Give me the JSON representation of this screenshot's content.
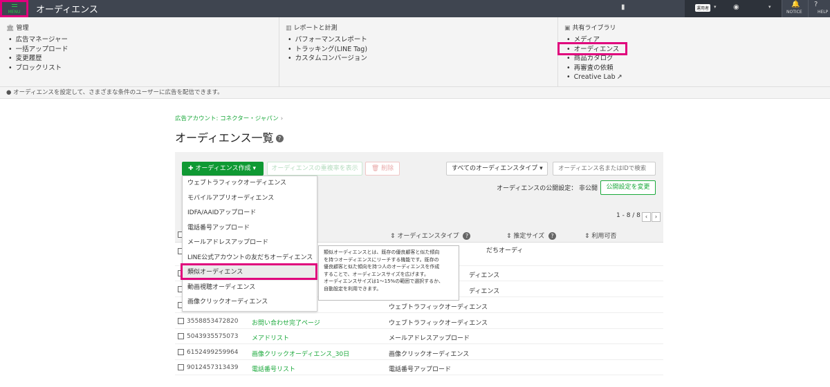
{
  "topbar": {
    "menu_label": "MENU",
    "title": "オーディエンス",
    "account": "運用者",
    "notice": "NOTICE",
    "help": "HELP"
  },
  "mega_menu": {
    "columns": [
      {
        "heading": "管理",
        "icon": "bank-icon",
        "items": [
          "広告マネージャー",
          "一括アップロード",
          "変更履歴",
          "ブロックリスト"
        ]
      },
      {
        "heading": "レポートと計測",
        "icon": "bar-chart-icon",
        "items": [
          "パフォーマンスレポート",
          "トラッキング(LINE Tag)",
          "カスタムコンバージョン"
        ]
      },
      {
        "heading": "共有ライブラリ",
        "icon": "image-icon",
        "items": [
          "メディア",
          "オーディエンス",
          "商品カタログ",
          "再審査の依頼",
          "Creative Lab"
        ]
      }
    ]
  },
  "info": "オーディエンスを設定して、さまざまな条件のユーザーに広告を配信できます。",
  "breadcrumb": {
    "account": "広告アカウント: コネクター・ジャパン",
    "sep": "›"
  },
  "page_title": "オーディエンス一覧",
  "toolbar": {
    "create_label": "オーディエンス作成",
    "share_label": "オーディエンスの重複率を表示",
    "delete_label": "削除",
    "type_filter": "すべてのオーディエンスタイプ",
    "search_placeholder": "オーディエンス名またはIDで検索",
    "public_setting_label": "オーディエンスの公開設定： 非公開",
    "public_change_label": "公開設定を変更"
  },
  "pager": {
    "text": "1 - 8 / 8"
  },
  "table": {
    "headers": {
      "type": "オーディエンスタイプ",
      "size": "推定サイズ",
      "usable": "利用可否"
    },
    "rows": [
      {
        "id": "",
        "name": "",
        "type": "だちオーディ"
      },
      {
        "id": "",
        "name": "",
        "type": "ディエンス"
      },
      {
        "id": "",
        "name": "",
        "type": "ディエンス"
      },
      {
        "id": "",
        "name": "",
        "type": "ウェブトラフィックオーディエンス"
      },
      {
        "id": "3558853472820",
        "name": "お問い合わせ完了ページ",
        "type": "ウェブトラフィックオーディエンス"
      },
      {
        "id": "5043935575073",
        "name": "メアドリスト",
        "type": "メールアドレスアップロード"
      },
      {
        "id": "6152499259964",
        "name": "画像クリックオーディエンス_30日",
        "type": "画像クリックオーディエンス"
      },
      {
        "id": "9012457313439",
        "name": "電話番号リスト",
        "type": "電話番号アップロード"
      }
    ]
  },
  "dropdown": {
    "items": [
      "ウェブトラフィックオーディエンス",
      "モバイルアプリオーディエンス",
      "IDFA/AAIDアップロード",
      "電話番号アップロード",
      "メールアドレスアップロード",
      "LINE公式アカウントの友だちオーディエンス",
      "類似オーディエンス",
      "動画視聴オーディエンス",
      "画像クリックオーディエンス"
    ]
  },
  "tooltip": {
    "lines": [
      "類似オーディエンスとは、既存の優良顧客と似た傾向",
      "を持つオーディエンスにリーチする機能です。既存の",
      "優良顧客と似た傾向を持つ人のオーディエンスを作成",
      "することで、オーディエンスサイズを広げます。",
      "オーディエンスサイズは1～15%の範囲で選択するか、",
      "自動設定を利用できます。"
    ]
  },
  "colors": {
    "accent": "#0f9933",
    "highlight": "#e0007c",
    "topbar": "#3f4550"
  }
}
